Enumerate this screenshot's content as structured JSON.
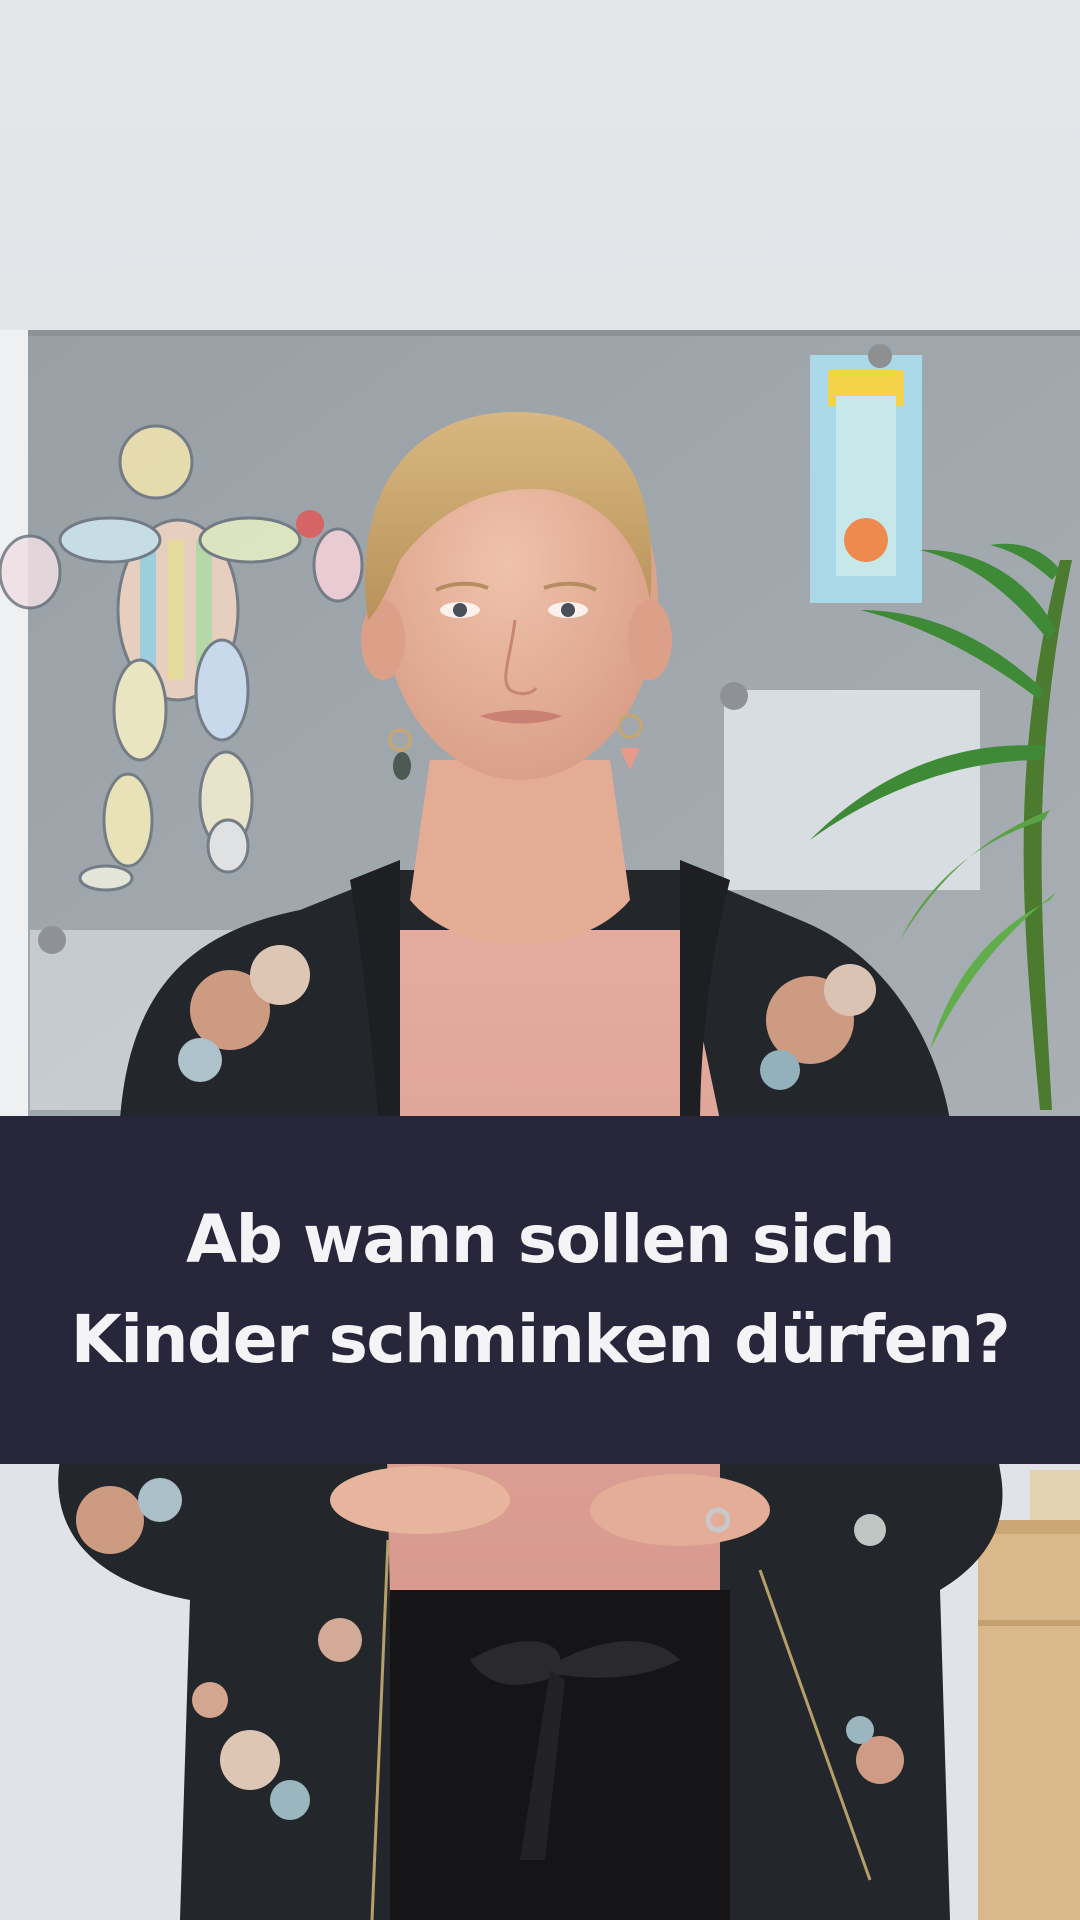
{
  "caption": {
    "line1": "Ab wann sollen sich",
    "line2": "Kinder schminken dürfen?"
  },
  "colors": {
    "caption_background": "#27263a",
    "caption_text": "#f4f4f6"
  },
  "icons": {
    "background_art": "drawn-figure-icon"
  }
}
